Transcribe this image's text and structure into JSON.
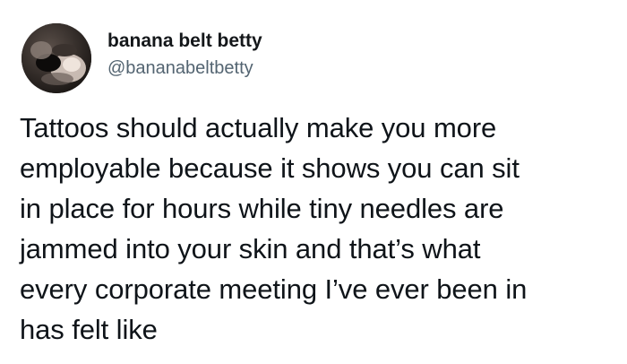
{
  "user": {
    "display_name": "banana belt betty",
    "handle": "@bananabeltbetty",
    "avatar_icon": "profile-photo"
  },
  "tweet": {
    "lines": [
      "Tattoos should actually make you more",
      "employable because it shows you can sit",
      "in place for hours while tiny needles are",
      "jammed into your skin and that’s what",
      "every corporate meeting I’ve ever been in",
      "has felt like"
    ]
  },
  "colors": {
    "background": "#ffffff",
    "text": "#0f1419",
    "handle": "#536471"
  }
}
